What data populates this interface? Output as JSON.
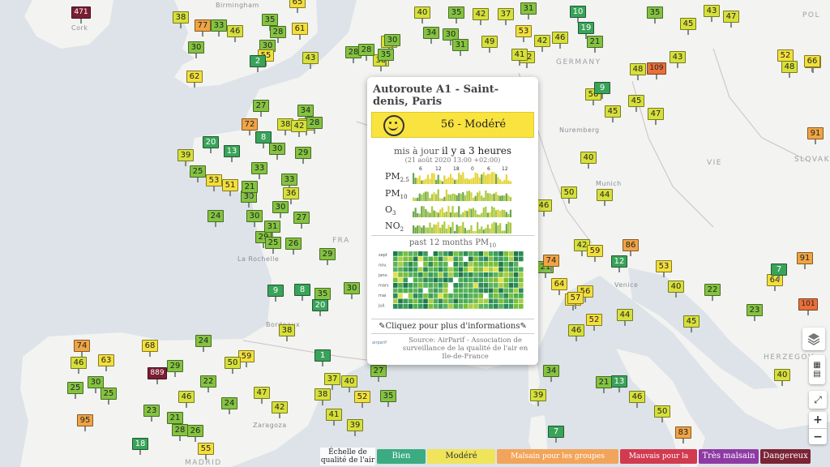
{
  "popup": {
    "title": "Autoroute A1 - Saint-denis, Paris",
    "aqi_text": "56 - Modéré",
    "aqi_color": "#f9e33f",
    "updated_prefix": "mis à jour",
    "updated_value": "il y a 3 heures",
    "updated_date": "(21 août 2020 13:00 +02:00)",
    "tick_labels": [
      "6",
      "12",
      "18",
      "0",
      "6",
      "12"
    ],
    "pollutants": [
      {
        "label": "PM",
        "sub": "2.5"
      },
      {
        "label": "PM",
        "sub": "10"
      },
      {
        "label": "O",
        "sub": "3"
      },
      {
        "label": "NO",
        "sub": "2"
      }
    ],
    "months_title_prefix": "past 12 months PM",
    "months_title_sub": "10",
    "month_labels": [
      "sept",
      "nov.",
      "janv.",
      "mars",
      "mai",
      "juil."
    ],
    "more_info": "Cliquez pour plus d'informations",
    "source_text": "Source: AirParif - Association de surveillance de la qualité de l'air en Ile-de-France",
    "source_logo": "airparif"
  },
  "legend": {
    "title": "Échelle de qualité de l'air",
    "items": [
      {
        "label": "Bien",
        "bg": "#3bab82",
        "fg": "#ffffff"
      },
      {
        "label": "Modéré",
        "bg": "#f0e45a",
        "fg": "#333333"
      },
      {
        "label": "Malsain pour les groupes sensibles",
        "bg": "#f2a55a",
        "fg": "#ffffff"
      },
      {
        "label": "Mauvais pour la santé",
        "bg": "#d23a4f",
        "fg": "#ffffff"
      },
      {
        "label": "Très malsain",
        "bg": "#8e3aa5",
        "fg": "#ffffff"
      },
      {
        "label": "Dangereux",
        "bg": "#7a2436",
        "fg": "#ffffff"
      }
    ]
  },
  "controls": {
    "layers_icon": "layers-icon",
    "fullscreen_icon": "fullscreen-icon",
    "zoom_in": "+",
    "zoom_out": "−"
  },
  "places": [
    {
      "name": "Birmingham"
    },
    {
      "name": "Cork"
    },
    {
      "name": "La Rochelle"
    },
    {
      "name": "GERMANY"
    },
    {
      "name": "Nuremberg"
    },
    {
      "name": "Munich"
    },
    {
      "name": "Venice"
    },
    {
      "name": "HERZEGOV"
    },
    {
      "name": "Zaragoza"
    },
    {
      "name": "MADRID"
    },
    {
      "name": "SLOVAKIA"
    },
    {
      "name": "POL"
    },
    {
      "name": "Bordeaux"
    },
    {
      "name": "VIE"
    },
    {
      "name": "FRA"
    }
  ],
  "markers": [
    {
      "v": "471"
    },
    {
      "v": "38"
    },
    {
      "v": "77"
    },
    {
      "v": "33"
    },
    {
      "v": "46"
    },
    {
      "v": "30"
    },
    {
      "v": "62"
    },
    {
      "v": "35"
    },
    {
      "v": "28"
    },
    {
      "v": "61"
    },
    {
      "v": "30"
    },
    {
      "v": "55"
    },
    {
      "v": "2"
    },
    {
      "v": "43"
    },
    {
      "v": "65"
    },
    {
      "v": "40"
    },
    {
      "v": "35"
    },
    {
      "v": "42"
    },
    {
      "v": "37"
    },
    {
      "v": "31"
    },
    {
      "v": "10"
    },
    {
      "v": "35"
    },
    {
      "v": "45"
    },
    {
      "v": "43"
    },
    {
      "v": "47"
    },
    {
      "v": "34"
    },
    {
      "v": "36"
    },
    {
      "v": "38"
    },
    {
      "v": "42"
    },
    {
      "v": "30"
    },
    {
      "v": "35"
    },
    {
      "v": "28"
    },
    {
      "v": "28"
    },
    {
      "v": "30"
    },
    {
      "v": "31"
    },
    {
      "v": "41"
    },
    {
      "v": "42"
    },
    {
      "v": "49"
    },
    {
      "v": "53"
    },
    {
      "v": "46"
    },
    {
      "v": "19"
    },
    {
      "v": "21"
    },
    {
      "v": "43"
    },
    {
      "v": "52"
    },
    {
      "v": "48"
    },
    {
      "v": "65"
    },
    {
      "v": "66"
    },
    {
      "v": "109"
    },
    {
      "v": "45"
    },
    {
      "v": "47"
    },
    {
      "v": "27"
    },
    {
      "v": "34"
    },
    {
      "v": "36"
    },
    {
      "v": "38"
    },
    {
      "v": "28"
    },
    {
      "v": "72"
    },
    {
      "v": "42"
    },
    {
      "v": "30"
    },
    {
      "v": "8"
    },
    {
      "v": "29"
    },
    {
      "v": "20"
    },
    {
      "v": "13"
    },
    {
      "v": "39"
    },
    {
      "v": "33"
    },
    {
      "v": "25"
    },
    {
      "v": "53"
    },
    {
      "v": "51"
    },
    {
      "v": "30"
    },
    {
      "v": "21"
    },
    {
      "v": "33"
    },
    {
      "v": "36"
    },
    {
      "v": "45"
    },
    {
      "v": "50"
    },
    {
      "v": "48"
    },
    {
      "v": "9"
    },
    {
      "v": "45"
    },
    {
      "v": "40"
    },
    {
      "v": "44"
    },
    {
      "v": "91"
    },
    {
      "v": "46"
    },
    {
      "v": "50"
    },
    {
      "v": "42"
    },
    {
      "v": "30"
    },
    {
      "v": "27"
    },
    {
      "v": "24"
    },
    {
      "v": "30"
    },
    {
      "v": "29"
    },
    {
      "v": "31"
    },
    {
      "v": "25"
    },
    {
      "v": "26"
    },
    {
      "v": "29"
    },
    {
      "v": "9"
    },
    {
      "v": "8"
    },
    {
      "v": "30"
    },
    {
      "v": "35"
    },
    {
      "v": "20"
    },
    {
      "v": "21"
    },
    {
      "v": "59"
    },
    {
      "v": "86"
    },
    {
      "v": "53"
    },
    {
      "v": "12"
    },
    {
      "v": "74"
    },
    {
      "v": "64"
    },
    {
      "v": "56"
    },
    {
      "v": "57"
    },
    {
      "v": "46"
    },
    {
      "v": "52"
    },
    {
      "v": "40"
    },
    {
      "v": "22"
    },
    {
      "v": "64"
    },
    {
      "v": "23"
    },
    {
      "v": "101"
    },
    {
      "v": "45"
    },
    {
      "v": "38"
    },
    {
      "v": "74"
    },
    {
      "v": "68"
    },
    {
      "v": "63"
    },
    {
      "v": "46"
    },
    {
      "v": "889"
    },
    {
      "v": "29"
    },
    {
      "v": "25"
    },
    {
      "v": "30"
    },
    {
      "v": "25"
    },
    {
      "v": "46"
    },
    {
      "v": "21"
    },
    {
      "v": "95"
    },
    {
      "v": "23"
    },
    {
      "v": "28"
    },
    {
      "v": "26"
    },
    {
      "v": "18"
    },
    {
      "v": "55"
    },
    {
      "v": "24"
    },
    {
      "v": "22"
    },
    {
      "v": "59"
    },
    {
      "v": "50"
    },
    {
      "v": "47"
    },
    {
      "v": "24"
    },
    {
      "v": "42"
    },
    {
      "v": "39"
    },
    {
      "v": "37"
    },
    {
      "v": "40"
    },
    {
      "v": "38"
    },
    {
      "v": "52"
    },
    {
      "v": "41"
    },
    {
      "v": "35"
    },
    {
      "v": "27"
    },
    {
      "v": "34"
    },
    {
      "v": "39"
    },
    {
      "v": "7"
    },
    {
      "v": "1"
    },
    {
      "v": "83"
    },
    {
      "v": "50"
    },
    {
      "v": "46"
    },
    {
      "v": "21"
    },
    {
      "v": "13"
    },
    {
      "v": "40"
    },
    {
      "v": "91"
    },
    {
      "v": "7"
    },
    {
      "v": "57"
    },
    {
      "v": "44"
    }
  ]
}
